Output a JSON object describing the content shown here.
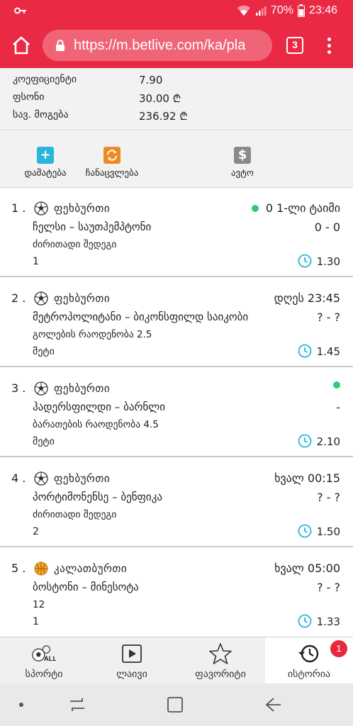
{
  "status_bar": {
    "battery": "70%",
    "time": "23:46"
  },
  "browser": {
    "url": "https://m.betlive.com/ka/pla",
    "tab_count": "3"
  },
  "summary": {
    "coef_label": "კოეფიციენტი",
    "coef_value": "7.90",
    "stake_label": "ფსონი",
    "stake_value": "30.00 ₾",
    "win_label": "სავ. მოგება",
    "win_value": "236.92 ₾"
  },
  "actions": {
    "add_label": "დამატება",
    "add_color": "#29b6d8",
    "replace_label": "ჩანაცვლება",
    "replace_color": "#f08a24",
    "auto_label": "ავტო",
    "auto_color": "#8a8a8a"
  },
  "bets": [
    {
      "num": "1 .",
      "sport": "ფეხბურთი",
      "sport_icon": "soccer-ball-icon",
      "status": "0 1-ლი ტაიმი",
      "live": true,
      "match": "ჩელსი – საუთჰემპტონი",
      "score": "0 - 0",
      "market": "ძირითადი შედეგი",
      "outcome": "1",
      "odd": "1.30"
    },
    {
      "num": "2 .",
      "sport": "ფეხბურთი",
      "sport_icon": "soccer-ball-icon",
      "status": "დღეს 23:45",
      "live": false,
      "match": "მეტროპოლიტანი – ბიკონსფილდ საიკობი",
      "score": "? - ?",
      "market": "გოლების რაოდენობა 2.5",
      "outcome": "მეტი",
      "odd": "1.45"
    },
    {
      "num": "3 .",
      "sport": "ფეხბურთი",
      "sport_icon": "soccer-ball-icon",
      "status": "",
      "live": true,
      "match": "ჰადერსფილდი – ბარნლი",
      "score": "-",
      "market": "ბარათების რაოდენობა 4.5",
      "outcome": "მეტი",
      "odd": "2.10"
    },
    {
      "num": "4 .",
      "sport": "ფეხბურთი",
      "sport_icon": "soccer-ball-icon",
      "status": "ხვალ 00:15",
      "live": false,
      "match": "პორტიმონენსე – ბენფიკა",
      "score": "? - ?",
      "market": "ძირითადი შედეგი",
      "outcome": "2",
      "odd": "1.50"
    },
    {
      "num": "5 .",
      "sport": "კალათბურთი",
      "sport_icon": "basketball-icon",
      "status": "ხვალ 05:00",
      "live": false,
      "match": "ბოსტონი – მინესოტა",
      "score": "? - ?",
      "market": "12",
      "outcome": "1",
      "odd": "1.33"
    }
  ],
  "bottom_nav": {
    "sports_label": "სპორტი",
    "sports_icon_text": "ALL",
    "live_label": "ლაივი",
    "fav_label": "ფავორიტი",
    "history_label": "ისტორია",
    "history_badge": "1"
  },
  "colors": {
    "brand": "#ea2945",
    "accent": "#29b6d8",
    "live": "#2ecc71"
  }
}
